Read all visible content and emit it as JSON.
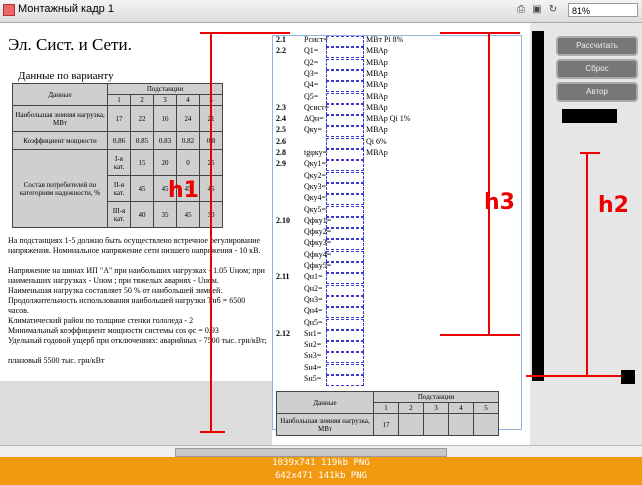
{
  "window": {
    "title": "Монтажный кадр 1",
    "zoom": "81%"
  },
  "left": {
    "heading": "Эл. Сист. и Сети.",
    "subhead": "Данные по варианту",
    "table": {
      "header": "Данные",
      "substations": "Подстанции",
      "cols": [
        "1",
        "2",
        "3",
        "4",
        "5"
      ],
      "rows": [
        {
          "label": "Наибольшая зимняя нагрузка, МВт",
          "values": [
            "17",
            "22",
            "16",
            "24",
            "21"
          ]
        },
        {
          "label": "Коэффициент мощности",
          "values": [
            "0.86",
            "0.85",
            "0.83",
            "0.82",
            "0.8"
          ]
        }
      ],
      "composition_label": "Состав потребителей по категориям надежности, %",
      "categories": [
        {
          "cat": "I-я кат.",
          "values": [
            "15",
            "20",
            "0",
            "25",
            "20"
          ]
        },
        {
          "cat": "II-я кат.",
          "values": [
            "45",
            "45",
            "45",
            "45",
            "45"
          ]
        },
        {
          "cat": "III-я кат.",
          "values": [
            "40",
            "35",
            "45",
            "30",
            "35"
          ]
        }
      ]
    },
    "paragraphs": [
      "На подстанциях 1-5 должно быть осуществлено встречное регулирование напряжения. Номинальное напряжение сети низшего напряжения - 10 кВ.",
      "Напряжение на шинах ИП \"А\" при наибольших нагрузках - 1.05 Uном; при наименьших нагрузках - Uном ; при тяжелых авариях - Uном.",
      "Наименьшая нагрузка составляет 50 % от наибольшей зимней.",
      "Продолжительность использования наибольшей нагрузки Тнб = 6500 часов.",
      "Климатический район по толщине стенки гололеда - 2",
      "Минимальный коэффициент мощности системы cos φс = 0.93",
      "Удельный годовой ущерб при отключениях: аварийных - 7500 тыс. грн/кВт;",
      "плановый 5500 тыс. грн/кВт"
    ]
  },
  "right": {
    "items": [
      {
        "num": "2.1",
        "text": "Pсист=",
        "tail": "МВт  Pi    8%"
      },
      {
        "num": "2.2",
        "text": "Q1=",
        "tail": "МВАр"
      },
      {
        "num": "",
        "text": "Q2=",
        "tail": "МВАр"
      },
      {
        "num": "",
        "text": "Q3=",
        "tail": "МВАр"
      },
      {
        "num": "",
        "text": "Q4=",
        "tail": "МВАр"
      },
      {
        "num": "",
        "text": "Q5=",
        "tail": "МВАр"
      },
      {
        "num": "2.3",
        "text": "Qсист=",
        "tail": "МВАр"
      },
      {
        "num": "2.4",
        "text": "ΔQн=",
        "tail": "МВАр Qi    1%"
      },
      {
        "num": "2.5",
        "text": "Qку=",
        "tail": "МВАр"
      },
      {
        "num": "2.6",
        "text": "",
        "tail": "Qi    6%"
      },
      {
        "num": "2.8",
        "text": "tgφку=",
        "tail": "МВАр"
      },
      {
        "num": "2.9",
        "text": "Qку1=",
        "tail": ""
      },
      {
        "num": "",
        "text": "Qку2=",
        "tail": ""
      },
      {
        "num": "",
        "text": "Qку3=",
        "tail": ""
      },
      {
        "num": "",
        "text": "Qку4=",
        "tail": ""
      },
      {
        "num": "",
        "text": "Qку5=",
        "tail": ""
      },
      {
        "num": "2.10",
        "text": "Qфку1=",
        "tail": ""
      },
      {
        "num": "",
        "text": "Qфку2=",
        "tail": ""
      },
      {
        "num": "",
        "text": "Qфку3=",
        "tail": ""
      },
      {
        "num": "",
        "text": "Qфку4=",
        "tail": ""
      },
      {
        "num": "",
        "text": "Qфку5=",
        "tail": ""
      },
      {
        "num": "2.11",
        "text": "Qн1=",
        "tail": ""
      },
      {
        "num": "",
        "text": "Qн2=",
        "tail": ""
      },
      {
        "num": "",
        "text": "Qн3=",
        "tail": ""
      },
      {
        "num": "",
        "text": "Qн4=",
        "tail": ""
      },
      {
        "num": "",
        "text": "Qн5=",
        "tail": ""
      },
      {
        "num": "2.12",
        "text": "Sн1=",
        "tail": ""
      },
      {
        "num": "",
        "text": "Sн2=",
        "tail": ""
      },
      {
        "num": "",
        "text": "Sн3=",
        "tail": ""
      },
      {
        "num": "",
        "text": "Sн4=",
        "tail": ""
      },
      {
        "num": "",
        "text": "Sн5=",
        "tail": ""
      }
    ],
    "table2": {
      "header": "Данные",
      "substations": "Подстанции",
      "cols": [
        "1",
        "2",
        "3",
        "4",
        "5"
      ],
      "row_label": "Наибольшая зимняя нагрузка, МВт",
      "first_value": "17"
    }
  },
  "buttons": {
    "calc": "Рассчитать",
    "reset": "Сброс",
    "author": "Автор"
  },
  "annotations": {
    "h1": "h1",
    "h2": "h2",
    "h3": "h3"
  },
  "colors": {
    "annotation": "#e00000",
    "footer": "#f19a0f",
    "field_border": "#3a3ad0"
  },
  "footer": {
    "line1": "1039x741  119kb  PNG",
    "line2": "642x471  141kb  PNG"
  }
}
